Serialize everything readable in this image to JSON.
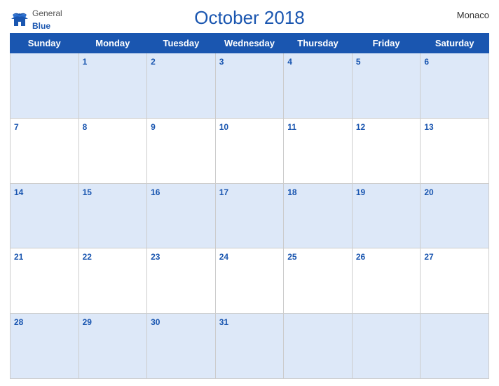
{
  "header": {
    "title": "October 2018",
    "country": "Monaco",
    "logo_general": "General",
    "logo_blue": "Blue"
  },
  "days_of_week": [
    "Sunday",
    "Monday",
    "Tuesday",
    "Wednesday",
    "Thursday",
    "Friday",
    "Saturday"
  ],
  "weeks": [
    [
      null,
      1,
      2,
      3,
      4,
      5,
      6
    ],
    [
      7,
      8,
      9,
      10,
      11,
      12,
      13
    ],
    [
      14,
      15,
      16,
      17,
      18,
      19,
      20
    ],
    [
      21,
      22,
      23,
      24,
      25,
      26,
      27
    ],
    [
      28,
      29,
      30,
      31,
      null,
      null,
      null
    ]
  ]
}
